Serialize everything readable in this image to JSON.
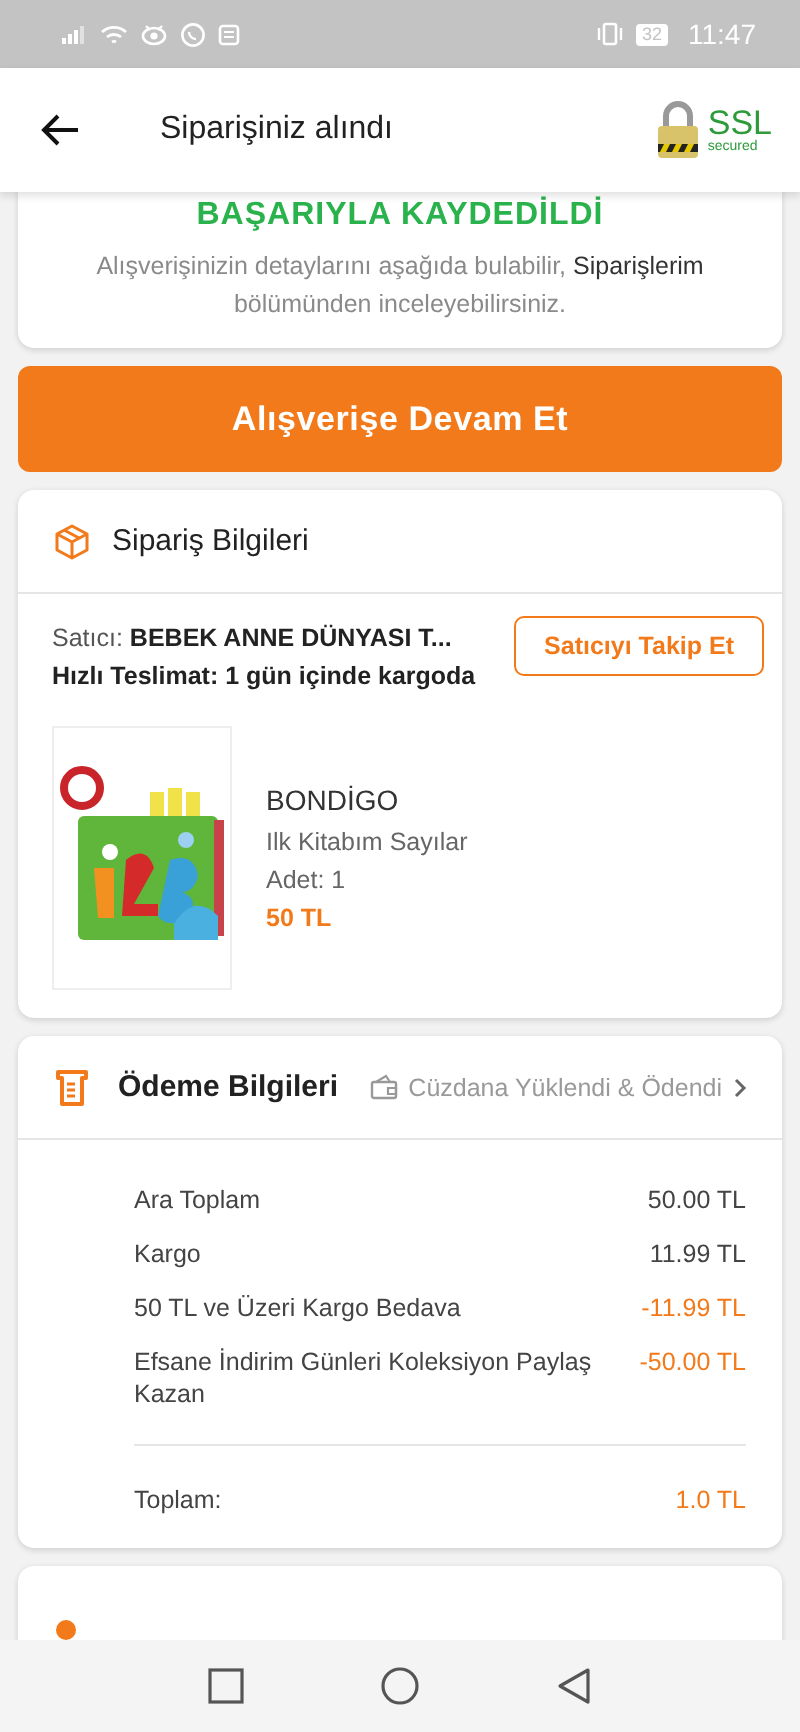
{
  "status_bar": {
    "battery": "32",
    "time": "11:47"
  },
  "header": {
    "title": "Siparişiniz alındı",
    "badge": "SSL",
    "badge_sub": "secured"
  },
  "confirmation": {
    "headline": "BAŞARIYLA KAYDEDİLDİ",
    "message": "Alışverişinizin detaylarını aşağıda bulabilir, **Siparişlerim** bölümünden inceleyebilirsiniz."
  },
  "continue_button": "Alışverişe Devam Et",
  "order_info": {
    "title": "Sipariş Bilgileri",
    "seller_label": "Satıcı:",
    "seller": "BEBEK ANNE DÜNYASI T...",
    "follow_button": "Satıcıyı Takip Et",
    "delivery": "Hızlı Teslimat: 1 gün içinde kargoda",
    "product": {
      "kind": "picture",
      "brand": "BONDİGO",
      "name": "Ilk Kitabım Sayılar",
      "quantity": "Adet: 1",
      "price": "50 TL"
    }
  },
  "payment_info": {
    "title": "Ödeme Bilgileri",
    "wallet_link": "Cüzdana Yüklendi & Ödendi",
    "rows": [
      {
        "label": "Ara Toplam",
        "value": "50.00 TL",
        "discount": false
      },
      {
        "label": "Kargo",
        "value": "11.99 TL",
        "discount": false
      },
      {
        "label": "50 TL ve Üzeri Kargo Bedava",
        "value": "-11.99 TL",
        "discount": true
      },
      {
        "label": "Efsane İndirim Günleri Koleksiyon Paylaş Kazan",
        "value": "-50.00 TL",
        "discount": true
      }
    ],
    "total_label": "Toplam:",
    "total": "1.0 TL"
  }
}
